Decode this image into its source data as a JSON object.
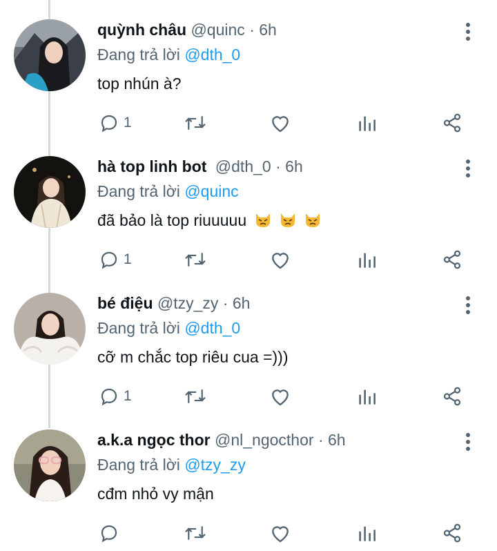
{
  "tweets": [
    {
      "name": "quỳnh châu",
      "handle": "@quinc",
      "separator": "·",
      "time": "6h",
      "reply_prefix": "Đang trả lời",
      "reply_to": "@dth_0",
      "text": "top nhún à?",
      "reply_count": "1",
      "emojis": []
    },
    {
      "name": "hà top linh bot",
      "handle": "@dth_0",
      "separator": "·",
      "time": "6h",
      "reply_prefix": "Đang trả lời",
      "reply_to": "@quinc",
      "text": "đã bảo là top riuuuuu",
      "reply_count": "1",
      "emojis": [
        "angry-cat-icon",
        "angry-cat-icon",
        "angry-cat-icon"
      ]
    },
    {
      "name": "bé điệu",
      "handle": "@tzy_zy",
      "separator": "·",
      "time": "6h",
      "reply_prefix": "Đang trả lời",
      "reply_to": "@dth_0",
      "text": "cỡ m chắc top riêu cua =)))",
      "reply_count": "1",
      "emojis": []
    },
    {
      "name": "a.k.a ngọc thor",
      "handle": "@nl_ngocthor",
      "separator": "·",
      "time": "6h",
      "reply_prefix": "Đang trả lời",
      "reply_to": "@tzy_zy",
      "text": "cđm nhỏ vy mận",
      "reply_count": "",
      "emojis": []
    }
  ],
  "colors": {
    "text": "#0f1419",
    "secondary": "#536471",
    "mention": "#1d9bf0",
    "thread_line": "#cfd9de"
  },
  "icons": [
    "reply-icon",
    "retweet-icon",
    "like-icon",
    "analytics-icon",
    "share-icon",
    "more-icon"
  ]
}
